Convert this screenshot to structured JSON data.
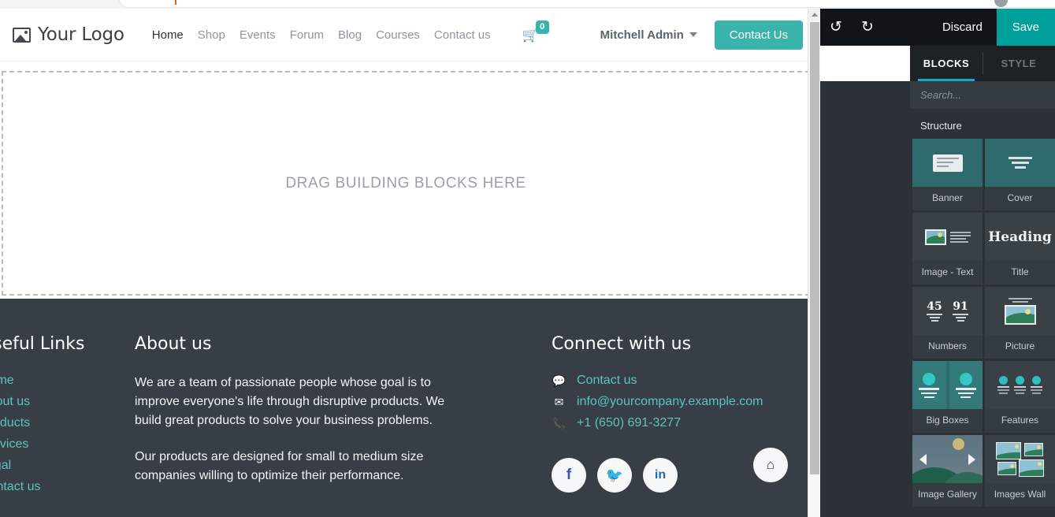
{
  "browser_chrome": {
    "present": true
  },
  "site": {
    "logo": {
      "text": "Your Logo",
      "icon": "picture-icon"
    },
    "nav": [
      {
        "label": "Home",
        "active": true
      },
      {
        "label": "Shop",
        "active": false
      },
      {
        "label": "Events",
        "active": false
      },
      {
        "label": "Forum",
        "active": false
      },
      {
        "label": "Blog",
        "active": false
      },
      {
        "label": "Courses",
        "active": false
      },
      {
        "label": "Contact us",
        "active": false
      }
    ],
    "cart": {
      "icon": "shopping-cart-icon",
      "count": "0",
      "badge_color": "#39b3ab"
    },
    "user_menu": {
      "label": "Mitchell Admin",
      "icon": "chevron-down-icon"
    },
    "cta_button": {
      "label": "Contact Us",
      "color": "#39b3ab"
    },
    "dropzone": {
      "text": "DRAG BUILDING BLOCKS HERE"
    },
    "footer": {
      "background": "#383e45",
      "link_color": "#5bc4bd",
      "useful_links": {
        "title": "Useful Links",
        "items": [
          "Home",
          "About us",
          "Products",
          "Services",
          "Legal",
          "Contact us"
        ]
      },
      "about": {
        "title": "About us",
        "paragraphs": [
          "We are a team of passionate people whose goal is to improve everyone's life through disruptive products. We build great products to solve your business problems.",
          "Our products are designed for small to medium size companies willing to optimize their performance."
        ]
      },
      "connect": {
        "title": "Connect with us",
        "rows": [
          {
            "icon": "comment-icon",
            "label": "Contact us"
          },
          {
            "icon": "envelope-icon",
            "label": "info@yourcompany.example.com"
          },
          {
            "icon": "phone-icon",
            "label": "+1 (650) 691-3277"
          }
        ],
        "socials": [
          {
            "icon": "facebook-icon",
            "label": "f"
          },
          {
            "icon": "twitter-icon",
            "label": "ᵗ"
          },
          {
            "icon": "linkedin-icon",
            "label": "in"
          },
          {
            "icon": "home-icon",
            "label": "⌂"
          }
        ]
      }
    }
  },
  "editor": {
    "toolbar": {
      "undo_icon": "undo-icon",
      "redo_icon": "redo-icon",
      "discard_label": "Discard",
      "save_label": "Save",
      "save_color": "#00a09d"
    },
    "tabs": [
      {
        "label": "BLOCKS",
        "active": true
      },
      {
        "label": "STYLE",
        "active": false
      }
    ],
    "active_tab_underline_color": "#18a5c6",
    "search": {
      "placeholder": "Search...",
      "value": ""
    },
    "sections": [
      {
        "label": "Structure",
        "blocks": [
          {
            "label": "Banner",
            "thumb": "banner-thumb",
            "style": "teal"
          },
          {
            "label": "Cover",
            "thumb": "cover-thumb",
            "style": "teal"
          },
          {
            "label": "Image - Text",
            "thumb": "image-text-thumb",
            "style": "dark"
          },
          {
            "label": "Title",
            "thumb": "title-thumb",
            "style": "dark",
            "thumb_text": "Heading"
          },
          {
            "label": "Numbers",
            "thumb": "numbers-thumb",
            "style": "dark",
            "numbers": [
              "45",
              "91"
            ]
          },
          {
            "label": "Picture",
            "thumb": "picture-thumb",
            "style": "dark"
          },
          {
            "label": "Big Boxes",
            "thumb": "big-boxes-thumb",
            "style": "teal"
          },
          {
            "label": "Features",
            "thumb": "features-thumb",
            "style": "dark"
          },
          {
            "label": "Image Gallery",
            "thumb": "image-gallery-thumb",
            "style": "dark"
          },
          {
            "label": "Images Wall",
            "thumb": "images-wall-thumb",
            "style": "dark"
          }
        ]
      }
    ]
  }
}
